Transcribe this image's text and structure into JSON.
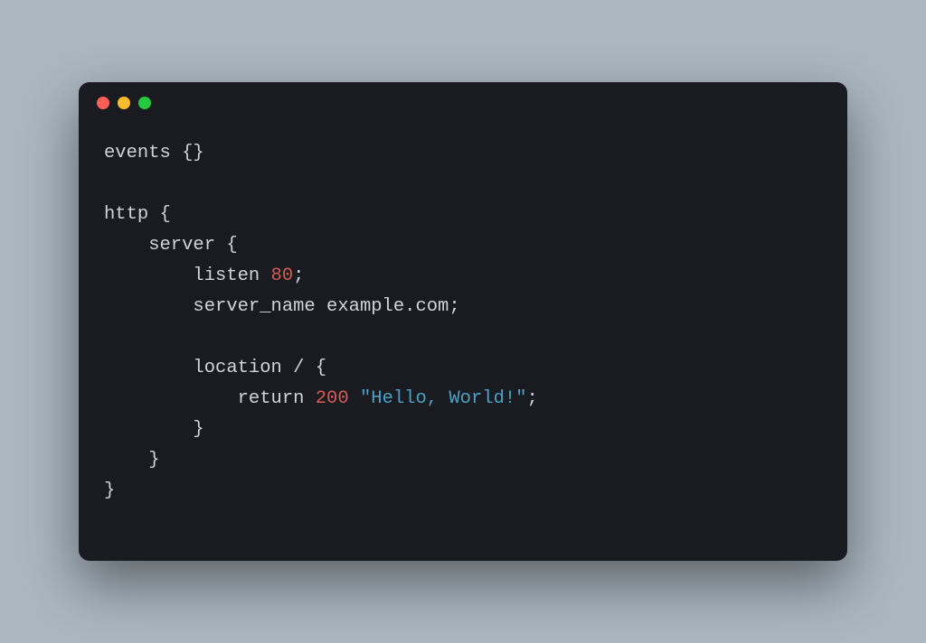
{
  "traffic_lights": {
    "close": "close",
    "minimize": "minimize",
    "zoom": "zoom"
  },
  "code": {
    "lines": [
      [
        {
          "cls": "plain",
          "text": "events {}"
        }
      ],
      [
        {
          "cls": "plain",
          "text": ""
        }
      ],
      [
        {
          "cls": "plain",
          "text": "http {"
        }
      ],
      [
        {
          "cls": "plain",
          "text": "    server {"
        }
      ],
      [
        {
          "cls": "plain",
          "text": "        listen "
        },
        {
          "cls": "number",
          "text": "80"
        },
        {
          "cls": "plain",
          "text": ";"
        }
      ],
      [
        {
          "cls": "plain",
          "text": "        server_name example.com;"
        }
      ],
      [
        {
          "cls": "plain",
          "text": ""
        }
      ],
      [
        {
          "cls": "plain",
          "text": "        location / {"
        }
      ],
      [
        {
          "cls": "plain",
          "text": "            return "
        },
        {
          "cls": "number",
          "text": "200"
        },
        {
          "cls": "plain",
          "text": " "
        },
        {
          "cls": "string",
          "text": "\"Hello, World!\""
        },
        {
          "cls": "plain",
          "text": ";"
        }
      ],
      [
        {
          "cls": "plain",
          "text": "        }"
        }
      ],
      [
        {
          "cls": "plain",
          "text": "    }"
        }
      ],
      [
        {
          "cls": "plain",
          "text": "}"
        }
      ]
    ]
  }
}
